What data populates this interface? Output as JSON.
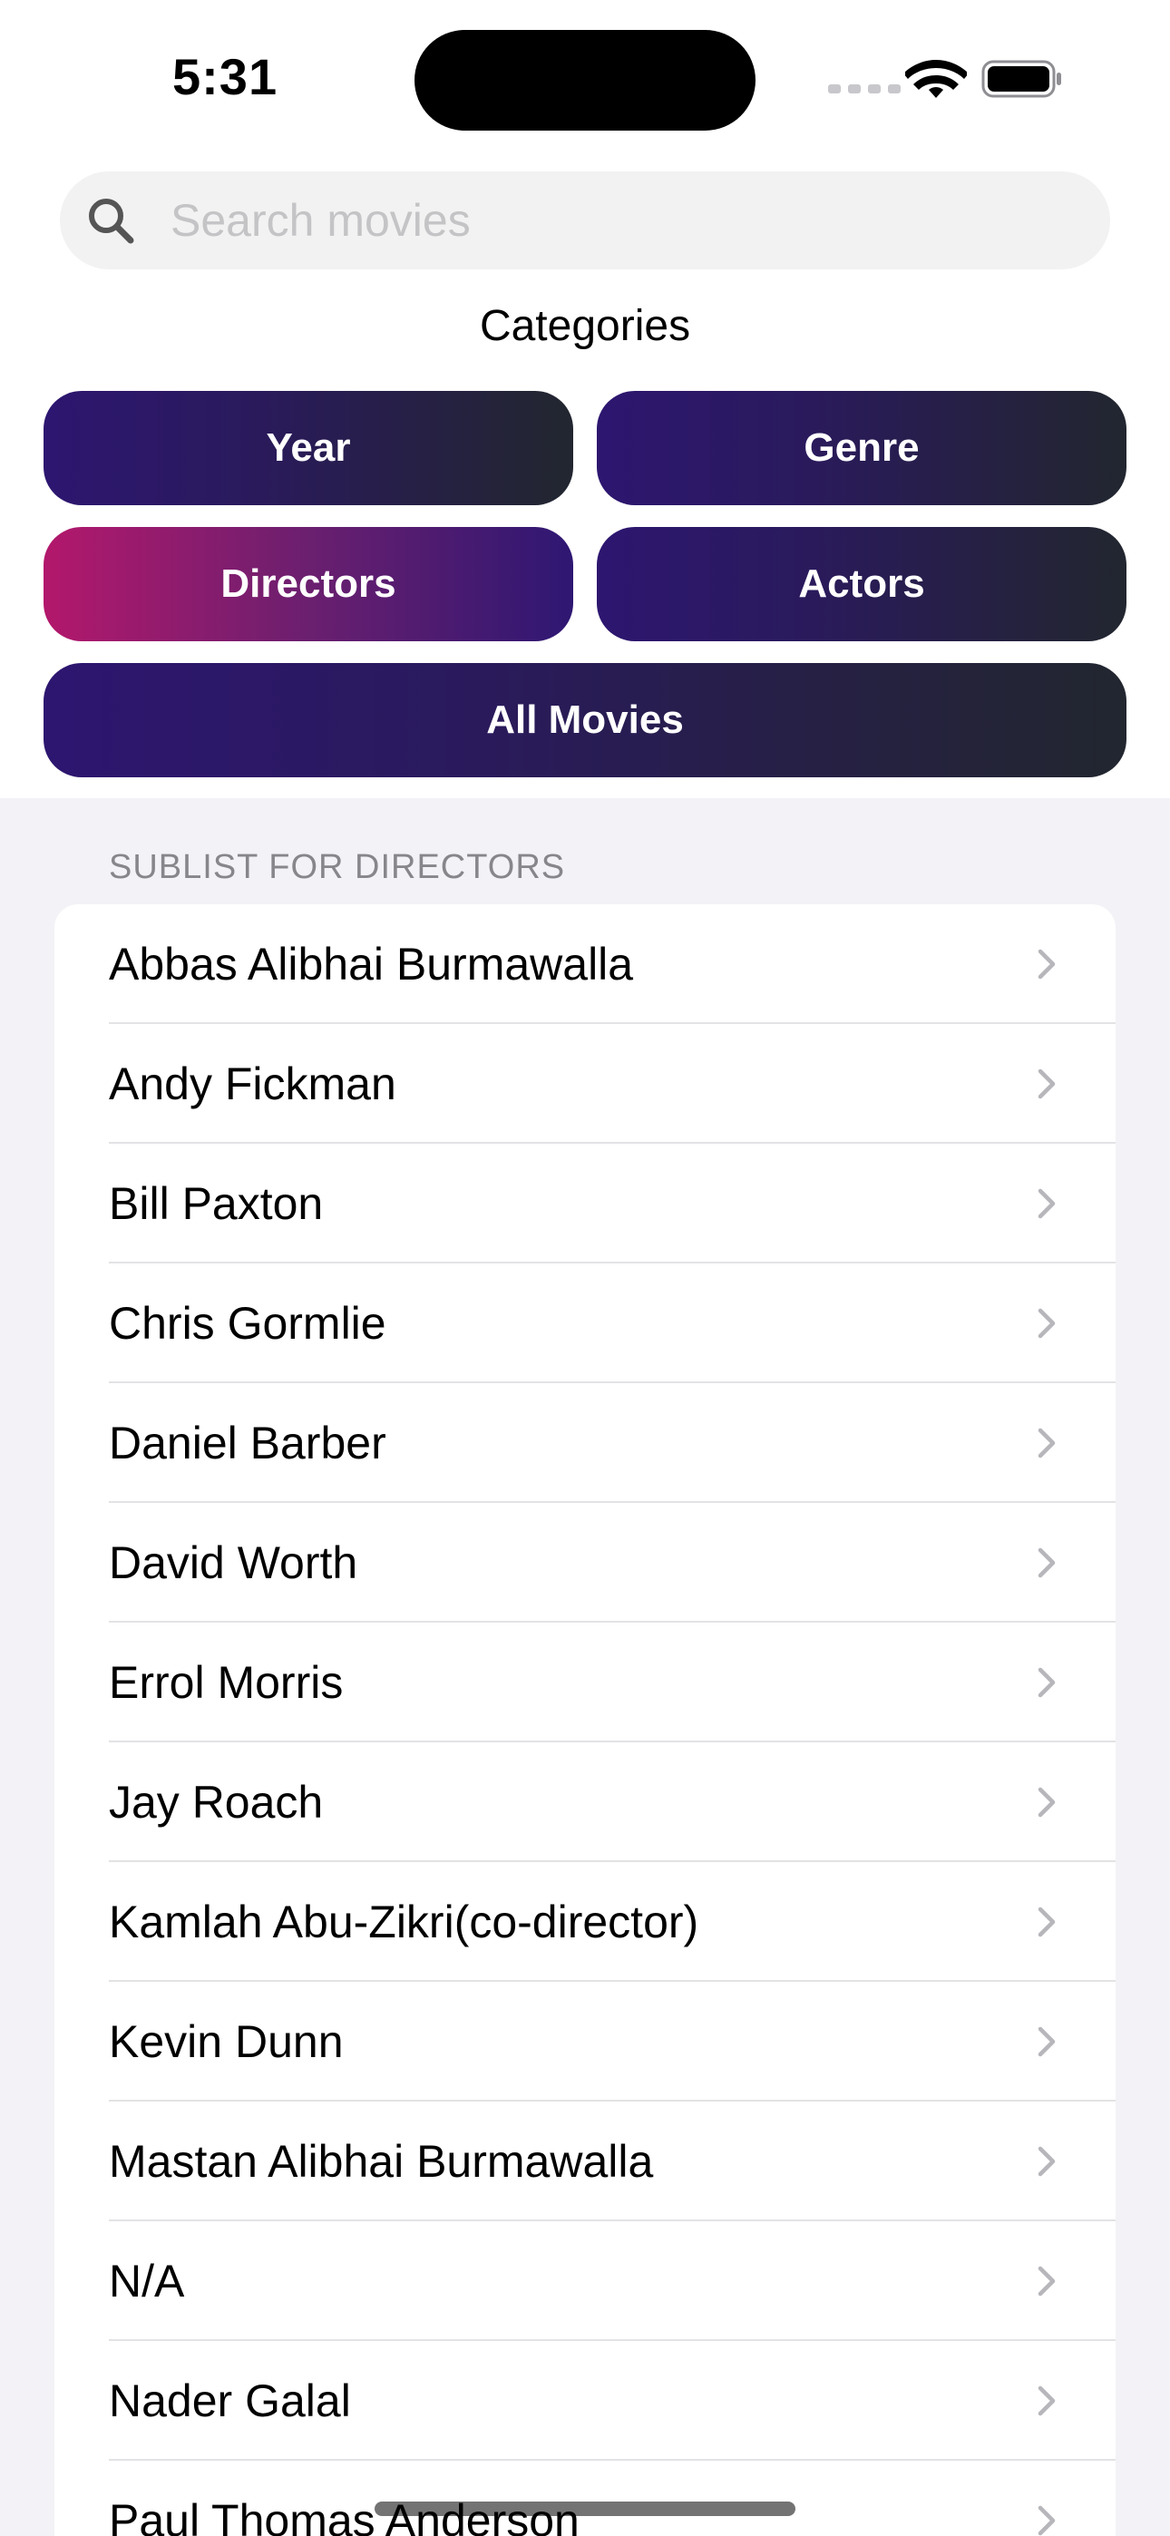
{
  "status_bar": {
    "time": "5:31"
  },
  "search": {
    "placeholder": "Search movies",
    "value": ""
  },
  "categories": {
    "title": "Categories",
    "buttons": [
      {
        "label": "Year",
        "active": false
      },
      {
        "label": "Genre",
        "active": false
      },
      {
        "label": "Directors",
        "active": true
      },
      {
        "label": "Actors",
        "active": false
      },
      {
        "label": "All Movies",
        "active": false
      }
    ]
  },
  "sublist": {
    "header": "SUBLIST FOR DIRECTORS",
    "items": [
      "Abbas Alibhai Burmawalla",
      "Andy Fickman",
      "Bill Paxton",
      "Chris Gormlie",
      "Daniel Barber",
      "David Worth",
      "Errol Morris",
      "Jay Roach",
      "Kamlah Abu-Zikri(co-director)",
      "Kevin Dunn",
      "Mastan Alibhai Burmawalla",
      "N/A",
      "Nader Galal",
      "Paul Thomas Anderson"
    ]
  },
  "colors": {
    "button_gradient": [
      "#2d1670",
      "#22262f"
    ],
    "active_gradient": [
      "#b3186c",
      "#2e1772"
    ],
    "background": "#f2f2f7"
  },
  "icons": {
    "search": "magnifying-glass",
    "row_accessory": "chevron-right",
    "wifi": "wifi",
    "battery": "battery-full"
  }
}
